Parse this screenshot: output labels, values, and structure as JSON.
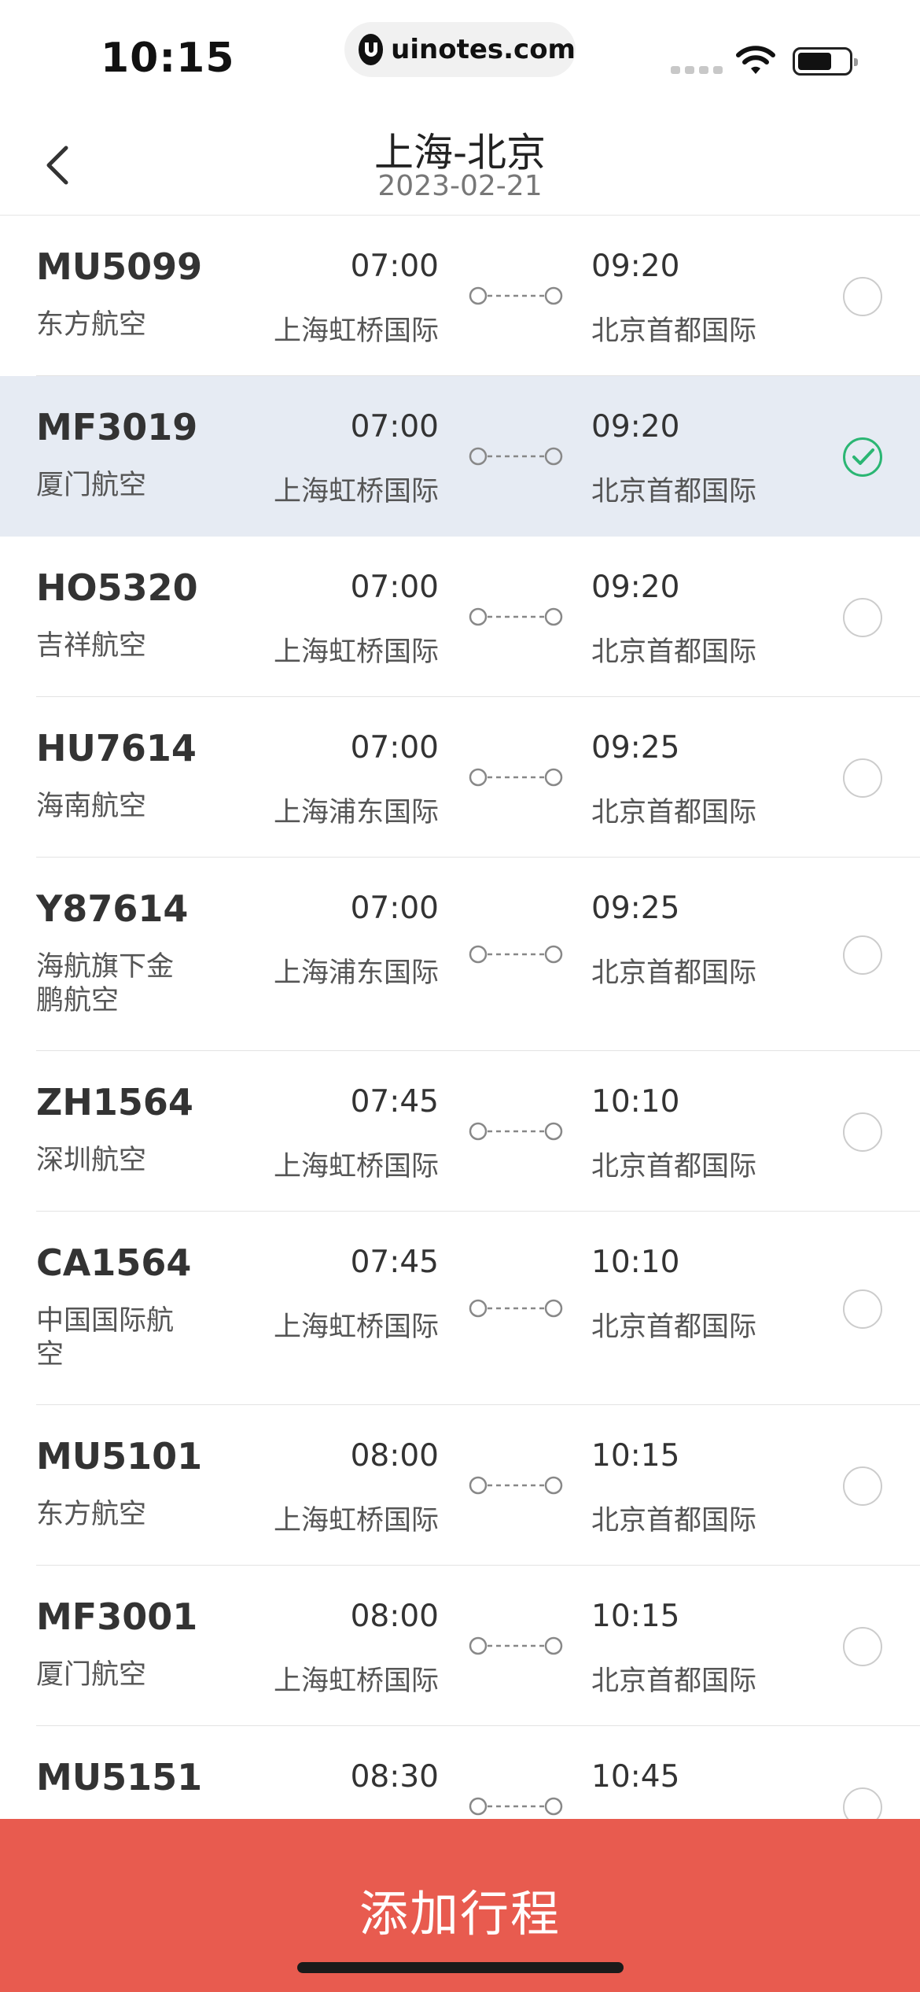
{
  "status_bar": {
    "time": "10:15",
    "url": "uinotes.com"
  },
  "header": {
    "title": "上海-北京",
    "date": "2023-02-21"
  },
  "flights": [
    {
      "no": "MU5099",
      "airline": "东方航空",
      "dep_time": "07:00",
      "dep_airport": "上海虹桥国际",
      "arr_time": "09:20",
      "arr_airport": "北京首都国际",
      "selected": false
    },
    {
      "no": "MF3019",
      "airline": "厦门航空",
      "dep_time": "07:00",
      "dep_airport": "上海虹桥国际",
      "arr_time": "09:20",
      "arr_airport": "北京首都国际",
      "selected": true
    },
    {
      "no": "HO5320",
      "airline": "吉祥航空",
      "dep_time": "07:00",
      "dep_airport": "上海虹桥国际",
      "arr_time": "09:20",
      "arr_airport": "北京首都国际",
      "selected": false
    },
    {
      "no": "HU7614",
      "airline": "海南航空",
      "dep_time": "07:00",
      "dep_airport": "上海浦东国际",
      "arr_time": "09:25",
      "arr_airport": "北京首都国际",
      "selected": false
    },
    {
      "no": "Y87614",
      "airline": "海航旗下金鹏航空",
      "dep_time": "07:00",
      "dep_airport": "上海浦东国际",
      "arr_time": "09:25",
      "arr_airport": "北京首都国际",
      "selected": false
    },
    {
      "no": "ZH1564",
      "airline": "深圳航空",
      "dep_time": "07:45",
      "dep_airport": "上海虹桥国际",
      "arr_time": "10:10",
      "arr_airport": "北京首都国际",
      "selected": false
    },
    {
      "no": "CA1564",
      "airline": "中国国际航空",
      "dep_time": "07:45",
      "dep_airport": "上海虹桥国际",
      "arr_time": "10:10",
      "arr_airport": "北京首都国际",
      "selected": false
    },
    {
      "no": "MU5101",
      "airline": "东方航空",
      "dep_time": "08:00",
      "dep_airport": "上海虹桥国际",
      "arr_time": "10:15",
      "arr_airport": "北京首都国际",
      "selected": false
    },
    {
      "no": "MF3001",
      "airline": "厦门航空",
      "dep_time": "08:00",
      "dep_airport": "上海虹桥国际",
      "arr_time": "10:15",
      "arr_airport": "北京首都国际",
      "selected": false
    },
    {
      "no": "MU5151",
      "airline": "",
      "dep_time": "08:30",
      "dep_airport": "",
      "arr_time": "10:45",
      "arr_airport": "",
      "selected": false
    }
  ],
  "action": {
    "label": "添加行程"
  },
  "colors": {
    "accent": "#e85b4f",
    "selected_row": "#e6ebf3",
    "check": "#2bb673"
  }
}
